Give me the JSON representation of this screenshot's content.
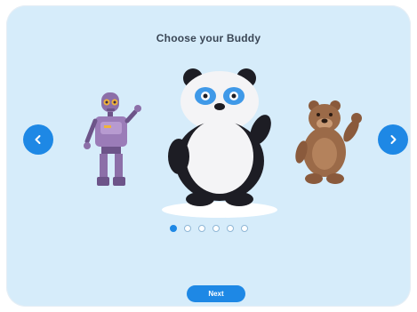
{
  "title": "Choose your Buddy",
  "carousel": {
    "prev_icon": "chevron-left-icon",
    "next_icon": "chevron-right-icon",
    "buddies": [
      {
        "name": "robot",
        "icon": "robot-icon"
      },
      {
        "name": "panda",
        "icon": "panda-icon",
        "selected": true
      },
      {
        "name": "bear",
        "icon": "bear-icon"
      }
    ],
    "page_count": 6,
    "active_page": 1
  },
  "next_button": {
    "label": "Next"
  },
  "colors": {
    "background": "#d6ecfa",
    "accent": "#1e88e5",
    "title_text": "#3a4655"
  }
}
